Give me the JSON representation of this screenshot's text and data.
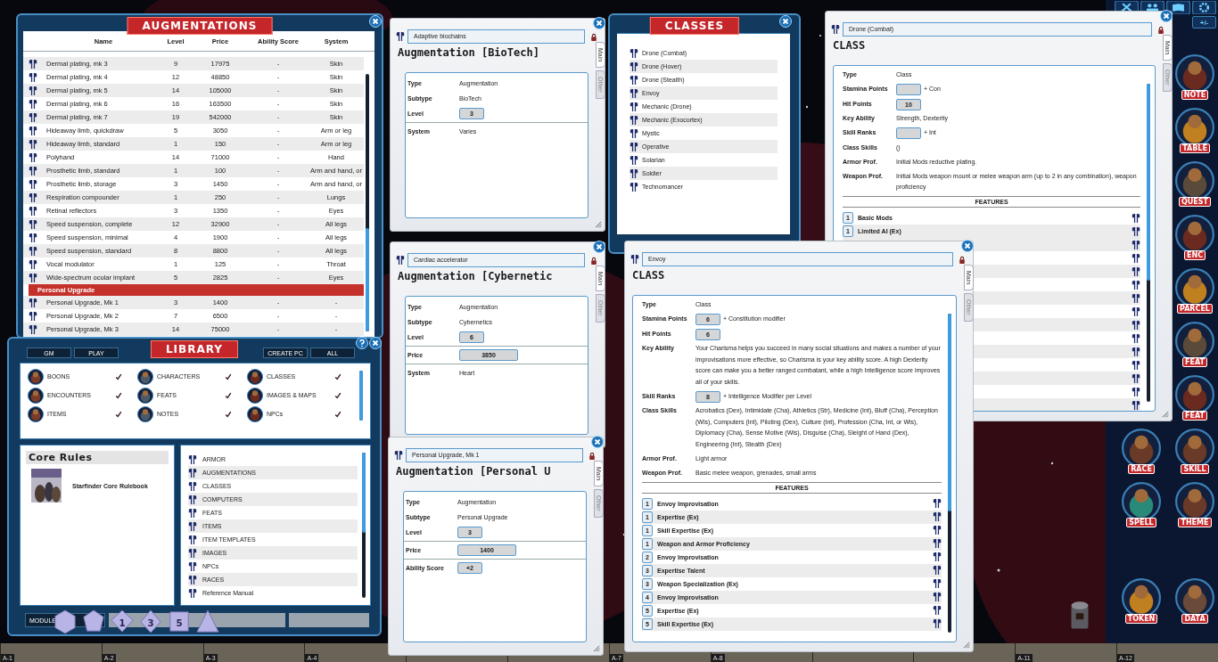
{
  "augmentations": {
    "title": "AUGMENTATIONS",
    "columns": [
      "Name",
      "Level",
      "Price",
      "Ability Score",
      "System"
    ],
    "rows": [
      {
        "kind": "item",
        "name": "Dermal plating, mk 3",
        "level": "9",
        "price": "17975",
        "ability": "-",
        "system": "Skin"
      },
      {
        "kind": "item",
        "name": "Dermal plating, mk 4",
        "level": "12",
        "price": "48850",
        "ability": "-",
        "system": "Skin"
      },
      {
        "kind": "item",
        "name": "Dermal plating, mk 5",
        "level": "14",
        "price": "105000",
        "ability": "-",
        "system": "Skin"
      },
      {
        "kind": "item",
        "name": "Dermal plating, mk 6",
        "level": "16",
        "price": "163500",
        "ability": "-",
        "system": "Skin"
      },
      {
        "kind": "item",
        "name": "Dermal plating, mk 7",
        "level": "19",
        "price": "542000",
        "ability": "-",
        "system": "Skin"
      },
      {
        "kind": "item",
        "name": "Hideaway limb, quickdraw",
        "level": "5",
        "price": "3050",
        "ability": "-",
        "system": "Arm or leg"
      },
      {
        "kind": "item",
        "name": "Hideaway limb, standard",
        "level": "1",
        "price": "150",
        "ability": "-",
        "system": "Arm or leg"
      },
      {
        "kind": "item",
        "name": "Polyhand",
        "level": "14",
        "price": "71000",
        "ability": "-",
        "system": "Hand"
      },
      {
        "kind": "item",
        "name": "Prosthetic limb, standard",
        "level": "1",
        "price": "100",
        "ability": "-",
        "system": "Arm and hand, or"
      },
      {
        "kind": "item",
        "name": "Prosthetic limb, storage",
        "level": "3",
        "price": "1450",
        "ability": "-",
        "system": "Arm and hand, or"
      },
      {
        "kind": "item",
        "name": "Respiration compounder",
        "level": "1",
        "price": "250",
        "ability": "-",
        "system": "Lungs"
      },
      {
        "kind": "item",
        "name": "Retinal reflectors",
        "level": "3",
        "price": "1350",
        "ability": "-",
        "system": "Eyes"
      },
      {
        "kind": "item",
        "name": "Speed suspension, complete",
        "level": "12",
        "price": "32900",
        "ability": "-",
        "system": "All legs"
      },
      {
        "kind": "item",
        "name": "Speed suspension, minimal",
        "level": "4",
        "price": "1900",
        "ability": "-",
        "system": "All legs"
      },
      {
        "kind": "item",
        "name": "Speed suspension, standard",
        "level": "8",
        "price": "8800",
        "ability": "-",
        "system": "All legs"
      },
      {
        "kind": "item",
        "name": "Vocal modulator",
        "level": "1",
        "price": "125",
        "ability": "-",
        "system": "Throat"
      },
      {
        "kind": "item",
        "name": "Wide-spectrum ocular implant",
        "level": "5",
        "price": "2825",
        "ability": "-",
        "system": "Eyes"
      },
      {
        "kind": "group",
        "name": "Personal Upgrade"
      },
      {
        "kind": "item",
        "name": "Personal Upgrade, Mk 1",
        "level": "3",
        "price": "1400",
        "ability": "-",
        "system": "-"
      },
      {
        "kind": "item",
        "name": "Personal Upgrade, Mk 2",
        "level": "7",
        "price": "6500",
        "ability": "-",
        "system": "-"
      },
      {
        "kind": "item",
        "name": "Personal Upgrade, Mk 3",
        "level": "14",
        "price": "75000",
        "ability": "-",
        "system": "-"
      }
    ]
  },
  "library": {
    "title": "LIBRARY",
    "left_buttons": [
      "GM",
      "PLAY"
    ],
    "right_buttons": [
      "CREATE PC",
      "ALL"
    ],
    "categories": [
      {
        "label": "BOONS",
        "checked": true
      },
      {
        "label": "CHARACTERS",
        "checked": true
      },
      {
        "label": "CLASSES",
        "checked": true
      },
      {
        "label": "ENCOUNTERS",
        "checked": true
      },
      {
        "label": "FEATS",
        "checked": true
      },
      {
        "label": "IMAGES & MAPS",
        "checked": true
      },
      {
        "label": "ITEMS",
        "checked": true
      },
      {
        "label": "NOTES",
        "checked": true
      },
      {
        "label": "NPCs",
        "checked": true
      }
    ],
    "module": {
      "title": "Core Rules",
      "book": "Starfinder Core Rulebook"
    },
    "entries": [
      "ARMOR",
      "AUGMENTATIONS",
      "CLASSES",
      "COMPUTERS",
      "FEATS",
      "ITEMS",
      "ITEM TEMPLATES",
      "IMAGES",
      "NPCs",
      "RACES",
      "Reference Manual"
    ],
    "bottom_tab": "MODULE"
  },
  "dice": [
    {
      "kind": "d20"
    },
    {
      "kind": "d12"
    },
    {
      "kind": "d10",
      "label": "1"
    },
    {
      "kind": "d8",
      "label": "3"
    },
    {
      "kind": "d6",
      "label": "5"
    },
    {
      "kind": "d4"
    }
  ],
  "item_windows": [
    {
      "name": "Adaptive biochains",
      "heading": "Augmentation [BioTech]",
      "tabs": [
        {
          "label": "Main",
          "selected": true
        },
        {
          "label": "Other",
          "selected": false
        }
      ],
      "sections": [
        [
          {
            "kind": "text",
            "label": "Type",
            "value": "Augmentation"
          },
          {
            "kind": "text",
            "label": "Subtype",
            "value": "BioTech"
          },
          {
            "kind": "box",
            "label": "Level",
            "value": "3"
          }
        ],
        [
          {
            "kind": "text",
            "label": "System",
            "value": "Varies"
          }
        ]
      ]
    },
    {
      "name": "Cardiac accelerator",
      "heading": "Augmentation [Cybernetic",
      "tabs": [
        {
          "label": "Main",
          "selected": true
        },
        {
          "label": "Other",
          "selected": false
        }
      ],
      "sections": [
        [
          {
            "kind": "text",
            "label": "Type",
            "value": "Augmentation"
          },
          {
            "kind": "text",
            "label": "Subtype",
            "value": "Cybernetics"
          },
          {
            "kind": "box",
            "label": "Level",
            "value": "6"
          }
        ],
        [
          {
            "kind": "wide",
            "label": "Price",
            "value": "3850"
          }
        ],
        [
          {
            "kind": "text",
            "label": "System",
            "value": "Heart"
          }
        ]
      ]
    },
    {
      "name": "Personal Upgrade, Mk 1",
      "heading": "Augmentation [Personal U",
      "tabs": [
        {
          "label": "Main",
          "selected": true
        },
        {
          "label": "Other",
          "selected": false
        }
      ],
      "sections": [
        [
          {
            "kind": "text",
            "label": "Type",
            "value": "Augmentation"
          },
          {
            "kind": "text",
            "label": "Subtype",
            "value": "Personal Upgrade"
          },
          {
            "kind": "box",
            "label": "Level",
            "value": "3"
          }
        ],
        [
          {
            "kind": "wide",
            "label": "Price",
            "value": "1400"
          }
        ],
        [
          {
            "kind": "box",
            "label": "Ability Score",
            "value": "+2"
          }
        ]
      ]
    }
  ],
  "classes": {
    "title": "CLASSES",
    "items": [
      "Drone (Combat)",
      "Drone (Hover)",
      "Drone (Stealth)",
      "Envoy",
      "Mechanic (Drone)",
      "Mechanic (Exocortex)",
      "Mystic",
      "Operative",
      "Solarian",
      "Soldier",
      "Technomancer"
    ]
  },
  "class_windows": [
    {
      "name": "Drone (Combat)",
      "heading": "CLASS",
      "tabs": [
        {
          "label": "Main",
          "selected": true
        },
        {
          "label": "Other",
          "selected": false
        }
      ],
      "fields": [
        {
          "kind": "text",
          "label": "Type",
          "value": "Class"
        },
        {
          "kind": "box",
          "label": "Stamina Points",
          "suffix": "+ Con"
        },
        {
          "kind": "box",
          "label": "Hit Points",
          "value": "10"
        },
        {
          "kind": "text",
          "label": "Key Ability",
          "value": "Strength, Dexterity"
        },
        {
          "kind": "box",
          "label": "Skill Ranks",
          "suffix": "+ Int"
        },
        {
          "kind": "text",
          "label": "Class Skills",
          "value": "()"
        },
        {
          "kind": "text",
          "label": "Armor Prof.",
          "value": "Initial Mods reductive plating."
        },
        {
          "kind": "text",
          "label": "Weapon Prof.",
          "value": "Initial Mods weapon mount or melee weapon arm (up to 2 in any combination), weapon proficiency"
        }
      ],
      "features_title": "FEATURES",
      "features": [
        {
          "level": "1",
          "name": "Basic Mods"
        },
        {
          "level": "1",
          "name": "Limited AI (Ex)"
        }
      ]
    },
    {
      "name": "Envoy",
      "heading": "CLASS",
      "tabs": [
        {
          "label": "Main",
          "selected": true
        },
        {
          "label": "Other",
          "selected": false
        }
      ],
      "fields": [
        {
          "kind": "text",
          "label": "Type",
          "value": "Class"
        },
        {
          "kind": "box",
          "label": "Stamina Points",
          "value": "6",
          "suffix": "+ Constitution modifier"
        },
        {
          "kind": "box",
          "label": "Hit Points",
          "value": "6"
        },
        {
          "kind": "text",
          "label": "Key Ability",
          "value": "Your Charisma helps you succeed in many social situations and makes a number of your improvisations more effective, so Charisma is your key ability score. A high Dexterity score can make you a better ranged combatant, while a high Intelligence score improves all of your skills."
        },
        {
          "kind": "box",
          "label": "Skill Ranks",
          "value": "8",
          "suffix": "+ Intelligence Modifier per Level"
        },
        {
          "kind": "text",
          "label": "Class Skills",
          "value": "Acrobatics (Dex), Intimidate (Cha), Athletics (Str), Medicine (Int), Bluff (Cha), Perception (Wis), Computers (Int), Piloting (Dex), Culture (Int), Profession (Cha, Int, or Wis), Diplomacy (Cha), Sense Motive (Wis), Disguise (Cha), Sleight of Hand (Dex), Engineering (Int), Stealth (Dex)"
        },
        {
          "kind": "text",
          "label": "Armor Prof.",
          "value": "Light armor"
        },
        {
          "kind": "text",
          "label": "Weapon Prof.",
          "value": "Basic melee weapon, grenades, small arms"
        }
      ],
      "features_title": "FEATURES",
      "features": [
        {
          "level": "1",
          "name": "Envoy Improvisation"
        },
        {
          "level": "1",
          "name": "Expertise (Ex)"
        },
        {
          "level": "1",
          "name": "Skill Expertise (Ex)"
        },
        {
          "level": "1",
          "name": "Weapon and Armor Proficiency"
        },
        {
          "level": "2",
          "name": "Envoy Improvisation"
        },
        {
          "level": "3",
          "name": "Expertise Talent"
        },
        {
          "level": "3",
          "name": "Weapon Specialization (Ex)"
        },
        {
          "level": "4",
          "name": "Envoy Improvisation"
        },
        {
          "level": "5",
          "name": "Expertise (Ex)"
        },
        {
          "level": "5",
          "name": "Skill Expertise (Ex)"
        }
      ]
    }
  ],
  "sidebar": {
    "toolbar_label": "+/-",
    "column_buttons": [
      "NOTE",
      "TABLE",
      "QUEST",
      "ENC",
      "PARCEL",
      "FEAT",
      "FEAT"
    ],
    "grid_buttons": [
      "RACE",
      "SKILL",
      "SPELL",
      "THEME"
    ],
    "bottom_buttons": [
      "TOKEN",
      "DATA"
    ]
  },
  "map_columns": [
    {
      "label": "A-1"
    },
    {
      "label": "A-2"
    },
    {
      "label": "A-3"
    },
    {
      "label": "A-4"
    },
    {},
    {},
    {
      "label": "A-7"
    },
    {
      "label": "A-8"
    },
    {},
    {},
    {
      "label": "A-11"
    },
    {
      "label": "A-12"
    }
  ]
}
